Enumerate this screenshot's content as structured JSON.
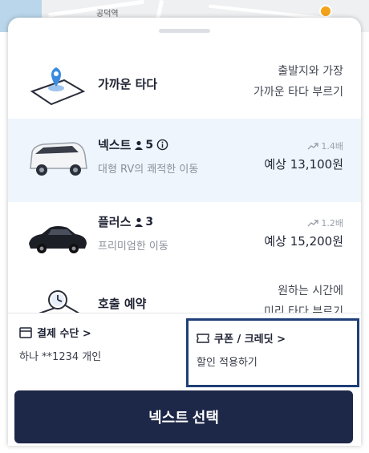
{
  "map": {
    "label": "공덕역"
  },
  "rides": [
    {
      "name": "가까운 타다",
      "desc_line1": "출발지와 가장",
      "desc_line2": "가까운 타다 부르기"
    },
    {
      "name": "넥스트",
      "capacity": "5",
      "subtitle": "대형 RV의 쾌적한 이동",
      "multiplier": "1.4배",
      "price": "예상 13,100원"
    },
    {
      "name": "플러스",
      "capacity": "3",
      "subtitle": "프리미엄한 이동",
      "multiplier": "1.2배",
      "price": "예상 15,200원"
    },
    {
      "name": "호출 예약",
      "desc_line1": "원하는 시간에",
      "desc_line2": "미리 타다 부르기"
    }
  ],
  "payment": {
    "title": "결제 수단 >",
    "value": "하나 **1234 개인"
  },
  "coupon": {
    "title": "쿠폰 / 크레딧 >",
    "value": "할인 적용하기"
  },
  "cta": {
    "label": "넥스트 선택"
  },
  "colors": {
    "selected_bg": "#eef5fc",
    "cta_bg": "#1d2747",
    "highlight_border": "#1f3f78"
  }
}
